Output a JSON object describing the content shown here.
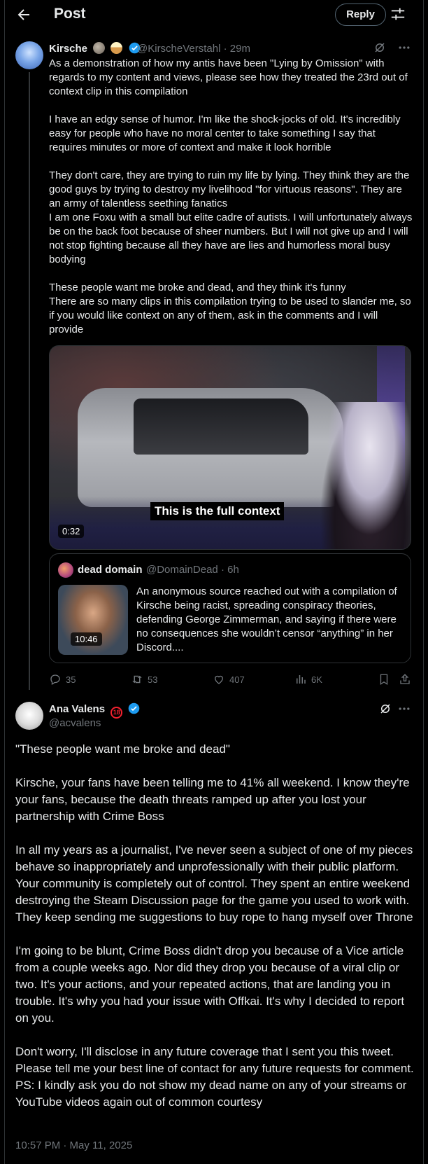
{
  "header": {
    "title": "Post",
    "reply_label": "Reply"
  },
  "tweet1": {
    "name": "Kirsche",
    "handle_time": "@KirscheVerstahl · 29m",
    "body": "As a demonstration of how my antis have been \"Lying by Omission\" with regards to my content and views, please see how they treated the 23rd out of context clip in this compilation\n\nI have an edgy sense of humor. I'm like the shock-jocks of old. It's incredibly easy for people who have no moral center to take something I say that requires minutes or more of context and make it look horrible\n\nThey don't care, they are trying to ruin my life by lying. They think they are the good guys by trying to destroy my livelihood \"for virtuous reasons\". They are an army of talentless seething fanatics\nI am one Foxu with a small but elite cadre of autists. I will unfortunately always be on the back foot because of sheer numbers. But I will not give up and I will not stop fighting because all they have are lies and humorless moral busy bodying\n\nThese people want me broke and dead, and they think it's funny\nThere are so many clips in this compilation trying to be used to slander me, so if you would like context on any of them, ask in the comments and I will provide",
    "video": {
      "caption": "This is the full context",
      "duration": "0:32"
    },
    "quote": {
      "name": "dead domain",
      "handle_time": "@DomainDead · 6h",
      "duration": "10:46",
      "text": "An anonymous source reached out with a compilation of Kirsche being racist, spreading conspiracy theories, defending George Zimmerman, and saying if there were no consequences she wouldn’t censor “anything” in her Discord...."
    },
    "stats": {
      "replies": "35",
      "reposts": "53",
      "likes": "407",
      "views": "6K"
    }
  },
  "tweet2": {
    "name": "Ana Valens",
    "handle": "@acvalens",
    "badge": "18",
    "body": "\"These people want me broke and dead\"\n\nKirsche, your fans have been telling me to 41% all weekend. I know they're your fans, because the death threats ramped up after you lost your partnership with Crime Boss\n\nIn all my years as a journalist, I've never seen a subject of one of my pieces behave so inappropriately and unprofessionally with their public platform. Your community is completely out of control. They spent an entire weekend destroying the Steam Discussion page for the game you used to work with. They keep sending me suggestions to buy rope to hang myself over Throne\n\nI'm going to be blunt, Crime Boss didn't drop you because of a Vice article from a couple weeks ago. Nor did they drop you because of a viral clip or two. It's your actions, and your repeated actions, that are landing you in trouble. It's why you had your issue with Offkai. It's why I decided to report on you.\n\nDon't worry, I'll disclose in any future coverage that I sent you this tweet. Please tell me your best line of contact for any future requests for comment. PS: I kindly ask you do not show my dead name on any of your streams or YouTube videos again out of common courtesy",
    "timestamp": "10:57 PM · May 11, 2025"
  },
  "colors": {
    "background": "#000000",
    "text": "#e7e9ea",
    "muted": "#71767b",
    "accent": "#1d9bf0",
    "border": "#2f3336"
  }
}
